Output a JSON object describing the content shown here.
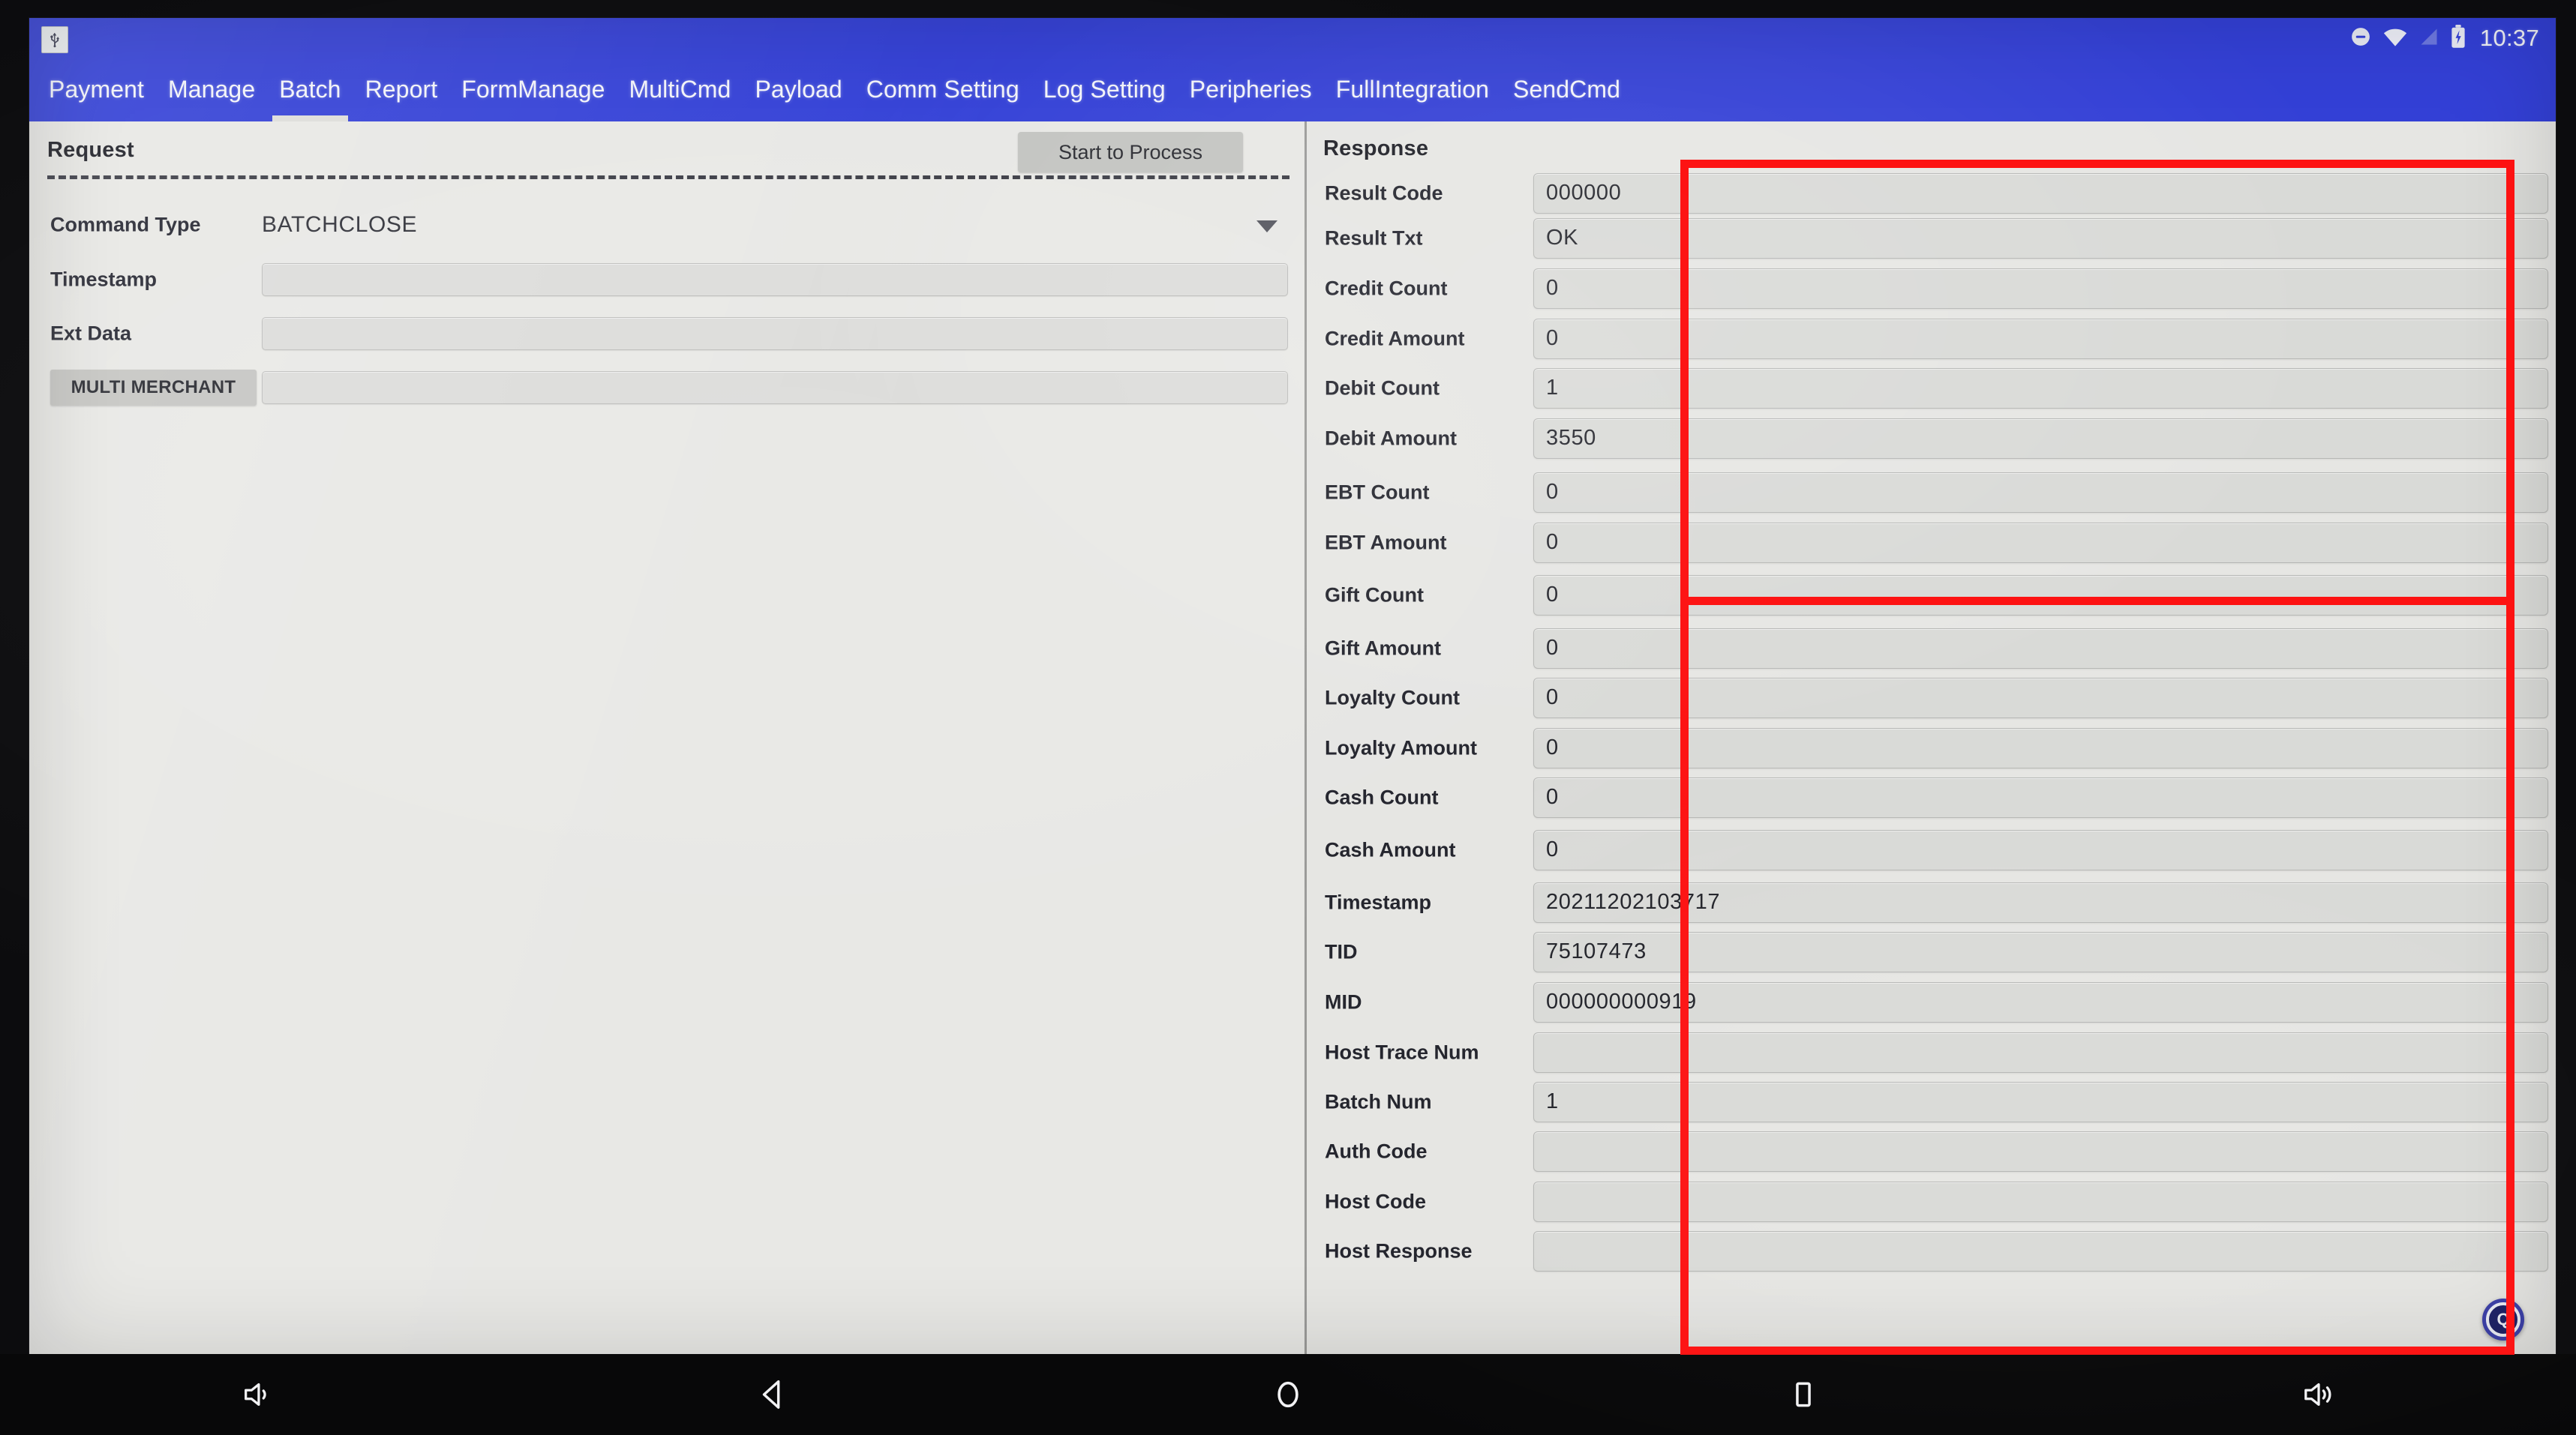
{
  "statusbar": {
    "usb_icon": "usb-icon",
    "icons": [
      "dnd-icon",
      "wifi-icon",
      "signal-icon",
      "battery-charging-icon"
    ],
    "clock": "10:37"
  },
  "tabs": [
    {
      "label": "Payment",
      "active": false
    },
    {
      "label": "Manage",
      "active": false
    },
    {
      "label": "Batch",
      "active": true
    },
    {
      "label": "Report",
      "active": false
    },
    {
      "label": "FormManage",
      "active": false
    },
    {
      "label": "MultiCmd",
      "active": false
    },
    {
      "label": "Payload",
      "active": false
    },
    {
      "label": "Comm Setting",
      "active": false
    },
    {
      "label": "Log Setting",
      "active": false
    },
    {
      "label": "Peripheries",
      "active": false
    },
    {
      "label": "FullIntegration",
      "active": false
    },
    {
      "label": "SendCmd",
      "active": false
    }
  ],
  "request": {
    "title": "Request",
    "start_button": "Start to Process",
    "command_type_label": "Command Type",
    "command_type_value": "BATCHCLOSE",
    "timestamp_label": "Timestamp",
    "timestamp_value": "",
    "ext_data_label": "Ext Data",
    "ext_data_value": "",
    "multi_merchant_button": "MULTI MERCHANT",
    "multi_merchant_value": ""
  },
  "response": {
    "title": "Response",
    "rows": [
      {
        "label": "Result Code",
        "value": "000000"
      },
      {
        "label": "Result Txt",
        "value": "OK"
      },
      {
        "label": "Credit Count",
        "value": "0"
      },
      {
        "label": "Credit Amount",
        "value": "0"
      },
      {
        "label": "Debit Count",
        "value": "1"
      },
      {
        "label": "Debit Amount",
        "value": "3550"
      },
      {
        "label": "EBT Count",
        "value": "0"
      },
      {
        "label": "EBT Amount",
        "value": "0"
      },
      {
        "label": "Gift Count",
        "value": "0"
      },
      {
        "label": "Gift Amount",
        "value": "0"
      },
      {
        "label": "Loyalty Count",
        "value": "0"
      },
      {
        "label": "Loyalty Amount",
        "value": "0"
      },
      {
        "label": "Cash Count",
        "value": "0"
      },
      {
        "label": "Cash Amount",
        "value": "0"
      },
      {
        "label": "Timestamp",
        "value": "20211202103717"
      },
      {
        "label": "TID",
        "value": "75107473"
      },
      {
        "label": "MID",
        "value": "000000000919"
      },
      {
        "label": "Host Trace Num",
        "value": ""
      },
      {
        "label": "Batch Num",
        "value": "1"
      },
      {
        "label": "Auth Code",
        "value": ""
      },
      {
        "label": "Host Code",
        "value": ""
      },
      {
        "label": "Host Response",
        "value": ""
      }
    ]
  },
  "floating_badge": {
    "label": "Q"
  },
  "navbar": {
    "items": [
      "volume-down-icon",
      "back-icon",
      "home-icon",
      "recents-icon",
      "volume-up-icon"
    ]
  },
  "annotation": {
    "color": "#fd1212",
    "target": "response-values-column"
  }
}
